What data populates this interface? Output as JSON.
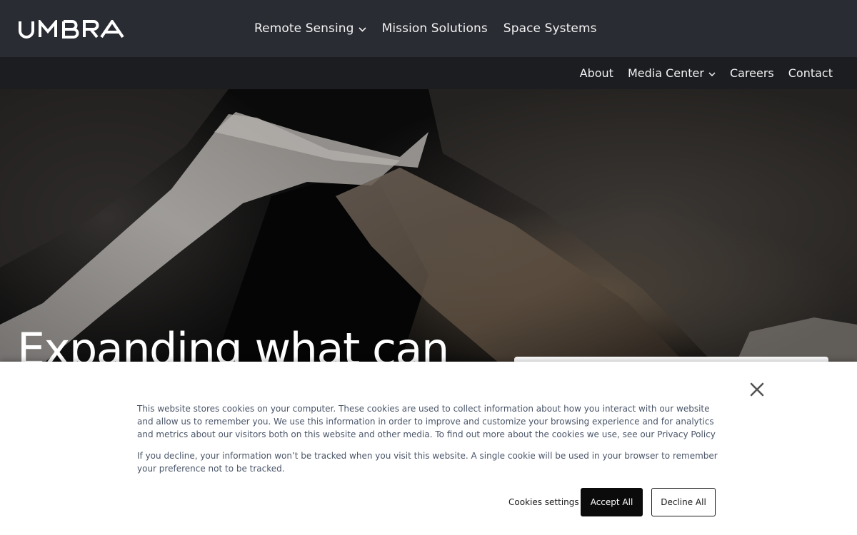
{
  "header": {
    "logo_text": "UMBRA",
    "primary_nav": [
      {
        "label": "Remote Sensing",
        "has_dropdown": true
      },
      {
        "label": "Mission Solutions",
        "has_dropdown": false
      },
      {
        "label": "Space Systems",
        "has_dropdown": false
      }
    ],
    "secondary_nav": [
      {
        "label": "About",
        "has_dropdown": false
      },
      {
        "label": "Media Center",
        "has_dropdown": true
      },
      {
        "label": "Careers",
        "has_dropdown": false
      },
      {
        "label": "Contact",
        "has_dropdown": false
      }
    ]
  },
  "hero": {
    "heading": "Expanding what can"
  },
  "cookie_banner": {
    "paragraph_1": "This website stores cookies on your computer. These cookies are used to collect information about how you interact with our website and allow us to remember you. We use this information in order to improve and customize your browsing experience and for analytics and metrics about our visitors both on this website and other media. To find out more about the cookies we use, see our Privacy Policy",
    "paragraph_2": "If you decline, your information won’t be tracked when you visit this website. A single cookie will be used in your browser to remember your preference not to be tracked.",
    "settings_label": "Cookies settings",
    "accept_label": "Accept All",
    "decline_label": "Decline All"
  },
  "colors": {
    "topnav_bg": "#2a2c33",
    "subnav_bg": "#1c1d21",
    "accept_bg": "#0b0b0c"
  },
  "icons": {
    "dropdown": "chevron-down-icon",
    "close": "close-icon"
  }
}
